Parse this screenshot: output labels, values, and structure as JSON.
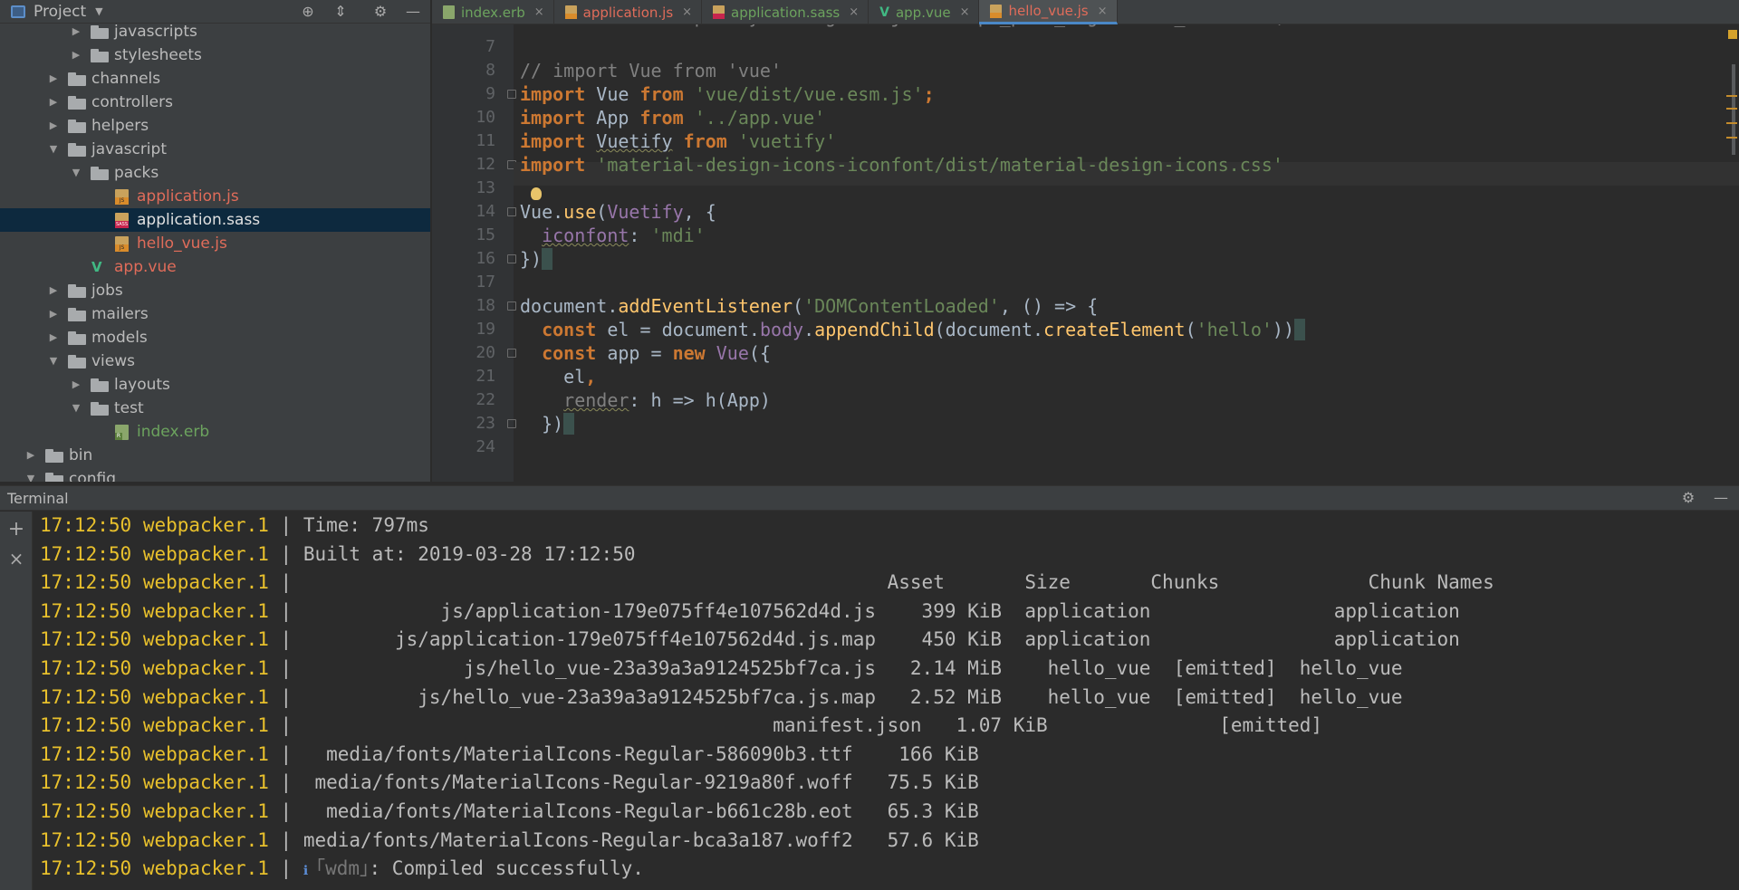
{
  "sidebar": {
    "title": "Project",
    "tree": [
      {
        "label": "javascripts",
        "depth": 3,
        "type": "folder",
        "expanded": false,
        "style": "default"
      },
      {
        "label": "stylesheets",
        "depth": 3,
        "type": "folder",
        "expanded": false,
        "style": "default"
      },
      {
        "label": "channels",
        "depth": 2,
        "type": "folder",
        "expanded": false,
        "style": "default"
      },
      {
        "label": "controllers",
        "depth": 2,
        "type": "folder",
        "expanded": false,
        "style": "default"
      },
      {
        "label": "helpers",
        "depth": 2,
        "type": "folder",
        "expanded": false,
        "style": "default"
      },
      {
        "label": "javascript",
        "depth": 2,
        "type": "folder",
        "expanded": true,
        "style": "default"
      },
      {
        "label": "packs",
        "depth": 3,
        "type": "folder",
        "expanded": true,
        "style": "default"
      },
      {
        "label": "application.js",
        "depth": 4,
        "type": "js",
        "style": "red"
      },
      {
        "label": "application.sass",
        "depth": 4,
        "type": "sass",
        "style": "white",
        "selected": true
      },
      {
        "label": "hello_vue.js",
        "depth": 4,
        "type": "js",
        "style": "red"
      },
      {
        "label": "app.vue",
        "depth": 3,
        "type": "vue",
        "style": "red"
      },
      {
        "label": "jobs",
        "depth": 2,
        "type": "folder",
        "expanded": false,
        "style": "default"
      },
      {
        "label": "mailers",
        "depth": 2,
        "type": "folder",
        "expanded": false,
        "style": "default"
      },
      {
        "label": "models",
        "depth": 2,
        "type": "folder",
        "expanded": false,
        "style": "default"
      },
      {
        "label": "views",
        "depth": 2,
        "type": "folder",
        "expanded": true,
        "style": "default"
      },
      {
        "label": "layouts",
        "depth": 3,
        "type": "folder",
        "expanded": false,
        "style": "default"
      },
      {
        "label": "test",
        "depth": 3,
        "type": "folder",
        "expanded": true,
        "style": "default"
      },
      {
        "label": "index.erb",
        "depth": 4,
        "type": "erb",
        "style": "green"
      },
      {
        "label": "bin",
        "depth": 1,
        "type": "folder",
        "expanded": false,
        "style": "default"
      },
      {
        "label": "config",
        "depth": 1,
        "type": "folder",
        "expanded": true,
        "style": "default"
      }
    ]
  },
  "tabs": [
    {
      "label": "index.erb",
      "type": "erb",
      "color": "#6ca35e",
      "active": false
    },
    {
      "label": "application.js",
      "type": "js",
      "color": "#e06c5a",
      "active": false
    },
    {
      "label": "application.sass",
      "type": "sass",
      "color": "#6ca35e",
      "active": false
    },
    {
      "label": "app.vue",
      "type": "vue",
      "color": "#6ca35e",
      "active": false
    },
    {
      "label": "hello_vue.js",
      "type": "js",
      "color": "#e06c5a",
      "active": true
    }
  ],
  "editor": {
    "partial_top_line": "// Run this example by adding <%= javascript_pack_tag 'hello_vue' %> (and",
    "lines": [
      {
        "n": "7",
        "tokens": []
      },
      {
        "n": "8",
        "tokens": [
          {
            "t": "// import Vue from 'vue'",
            "c": "cmt"
          }
        ]
      },
      {
        "n": "9",
        "tokens": [
          {
            "t": "import ",
            "c": "kw"
          },
          {
            "t": "Vue ",
            "c": "cls"
          },
          {
            "t": "from ",
            "c": "kw"
          },
          {
            "t": "'vue/dist/vue.esm.js'",
            "c": "str"
          },
          {
            "t": ";",
            "c": "kw"
          }
        ]
      },
      {
        "n": "10",
        "tokens": [
          {
            "t": "import ",
            "c": "kw"
          },
          {
            "t": "App ",
            "c": "cls"
          },
          {
            "t": "from ",
            "c": "kw"
          },
          {
            "t": "'../app.vue'",
            "c": "str"
          }
        ]
      },
      {
        "n": "11",
        "tokens": [
          {
            "t": "import ",
            "c": "kw"
          },
          {
            "t": "Vuetify",
            "c": "cls und"
          },
          {
            "t": " from ",
            "c": "kw"
          },
          {
            "t": "'vuetify'",
            "c": "str"
          }
        ]
      },
      {
        "n": "12",
        "tokens": [
          {
            "t": "import ",
            "c": "kw"
          },
          {
            "t": "'material-design-icons-iconfont/dist/material-design-icons.css'",
            "c": "str"
          }
        ]
      },
      {
        "n": "13",
        "tokens": []
      },
      {
        "n": "14",
        "tokens": [
          {
            "t": "Vue",
            "c": "cls"
          },
          {
            "t": ".",
            "c": "cls"
          },
          {
            "t": "use",
            "c": "fn"
          },
          {
            "t": "(",
            "c": "cls"
          },
          {
            "t": "Vuetify",
            "c": "prop"
          },
          {
            "t": ", {",
            "c": "cls"
          }
        ]
      },
      {
        "n": "15",
        "tokens": [
          {
            "t": "  ",
            "c": "cls"
          },
          {
            "t": "iconfont",
            "c": "prop und"
          },
          {
            "t": ": ",
            "c": "cls"
          },
          {
            "t": "'mdi'",
            "c": "str"
          }
        ]
      },
      {
        "n": "16",
        "tokens": [
          {
            "t": "})",
            "c": "cls"
          },
          {
            "t": " ",
            "c": "brk"
          }
        ]
      },
      {
        "n": "17",
        "tokens": []
      },
      {
        "n": "18",
        "tokens": [
          {
            "t": "document",
            "c": "cls"
          },
          {
            "t": ".",
            "c": "cls"
          },
          {
            "t": "addEventListener",
            "c": "fn"
          },
          {
            "t": "(",
            "c": "cls"
          },
          {
            "t": "'DOMContentLoaded'",
            "c": "str"
          },
          {
            "t": ", () => {",
            "c": "cls"
          }
        ]
      },
      {
        "n": "19",
        "tokens": [
          {
            "t": "  ",
            "c": "cls"
          },
          {
            "t": "const ",
            "c": "kw"
          },
          {
            "t": "el = ",
            "c": "cls"
          },
          {
            "t": "document",
            "c": "cls"
          },
          {
            "t": ".",
            "c": "cls"
          },
          {
            "t": "body",
            "c": "prop"
          },
          {
            "t": ".",
            "c": "cls"
          },
          {
            "t": "appendChild",
            "c": "fn"
          },
          {
            "t": "(document.",
            "c": "cls"
          },
          {
            "t": "createElement",
            "c": "fn"
          },
          {
            "t": "(",
            "c": "cls"
          },
          {
            "t": "'hello'",
            "c": "str"
          },
          {
            "t": "))",
            "c": "cls"
          },
          {
            "t": " ",
            "c": "brk"
          }
        ]
      },
      {
        "n": "20",
        "tokens": [
          {
            "t": "  ",
            "c": "cls"
          },
          {
            "t": "const ",
            "c": "kw"
          },
          {
            "t": "app = ",
            "c": "cls"
          },
          {
            "t": "new ",
            "c": "kw"
          },
          {
            "t": "Vue",
            "c": "prop"
          },
          {
            "t": "({",
            "c": "cls"
          }
        ]
      },
      {
        "n": "21",
        "tokens": [
          {
            "t": "    el",
            "c": "cls"
          },
          {
            "t": ",",
            "c": "kw"
          }
        ]
      },
      {
        "n": "22",
        "tokens": [
          {
            "t": "    ",
            "c": "cls"
          },
          {
            "t": "render",
            "c": "cmt und"
          },
          {
            "t": ": h => h(App)",
            "c": "cls"
          }
        ]
      },
      {
        "n": "23",
        "tokens": [
          {
            "t": "  })",
            "c": "cls"
          },
          {
            "t": " ",
            "c": "brk"
          }
        ]
      },
      {
        "n": "24",
        "tokens": []
      }
    ]
  },
  "terminal": {
    "title": "Terminal",
    "lines": [
      {
        "time": "17:12:50",
        "proc": "webpacker.1",
        "text": "Time: 797ms"
      },
      {
        "time": "17:12:50",
        "proc": "webpacker.1",
        "text": "Built at: 2019-03-28 17:12:50"
      },
      {
        "time": "17:12:50",
        "proc": "webpacker.1",
        "text": "                                                   Asset       Size       Chunks             Chunk Names"
      },
      {
        "time": "17:12:50",
        "proc": "webpacker.1",
        "text": "            js/application-179e075ff4e107562d4d.js    399 KiB  application                application"
      },
      {
        "time": "17:12:50",
        "proc": "webpacker.1",
        "text": "        js/application-179e075ff4e107562d4d.js.map    450 KiB  application                application"
      },
      {
        "time": "17:12:50",
        "proc": "webpacker.1",
        "text": "              js/hello_vue-23a39a3a9124525bf7ca.js   2.14 MiB    hello_vue  [emitted]  hello_vue"
      },
      {
        "time": "17:12:50",
        "proc": "webpacker.1",
        "text": "          js/hello_vue-23a39a3a9124525bf7ca.js.map   2.52 MiB    hello_vue  [emitted]  hello_vue"
      },
      {
        "time": "17:12:50",
        "proc": "webpacker.1",
        "text": "                                         manifest.json   1.07 KiB               [emitted]"
      },
      {
        "time": "17:12:50",
        "proc": "webpacker.1",
        "text": "  media/fonts/MaterialIcons-Regular-586090b3.ttf    166 KiB"
      },
      {
        "time": "17:12:50",
        "proc": "webpacker.1",
        "text": " media/fonts/MaterialIcons-Regular-9219a80f.woff   75.5 KiB"
      },
      {
        "time": "17:12:50",
        "proc": "webpacker.1",
        "text": "  media/fonts/MaterialIcons-Regular-b661c28b.eot   65.3 KiB"
      },
      {
        "time": "17:12:50",
        "proc": "webpacker.1",
        "text": "media/fonts/MaterialIcons-Regular-bca3a187.woff2   57.6 KiB"
      },
      {
        "time": "17:12:50",
        "proc": "webpacker.1",
        "text": "",
        "info": true,
        "wdm": "｢wdm｣",
        "info_text": ": Compiled successfully."
      }
    ]
  }
}
